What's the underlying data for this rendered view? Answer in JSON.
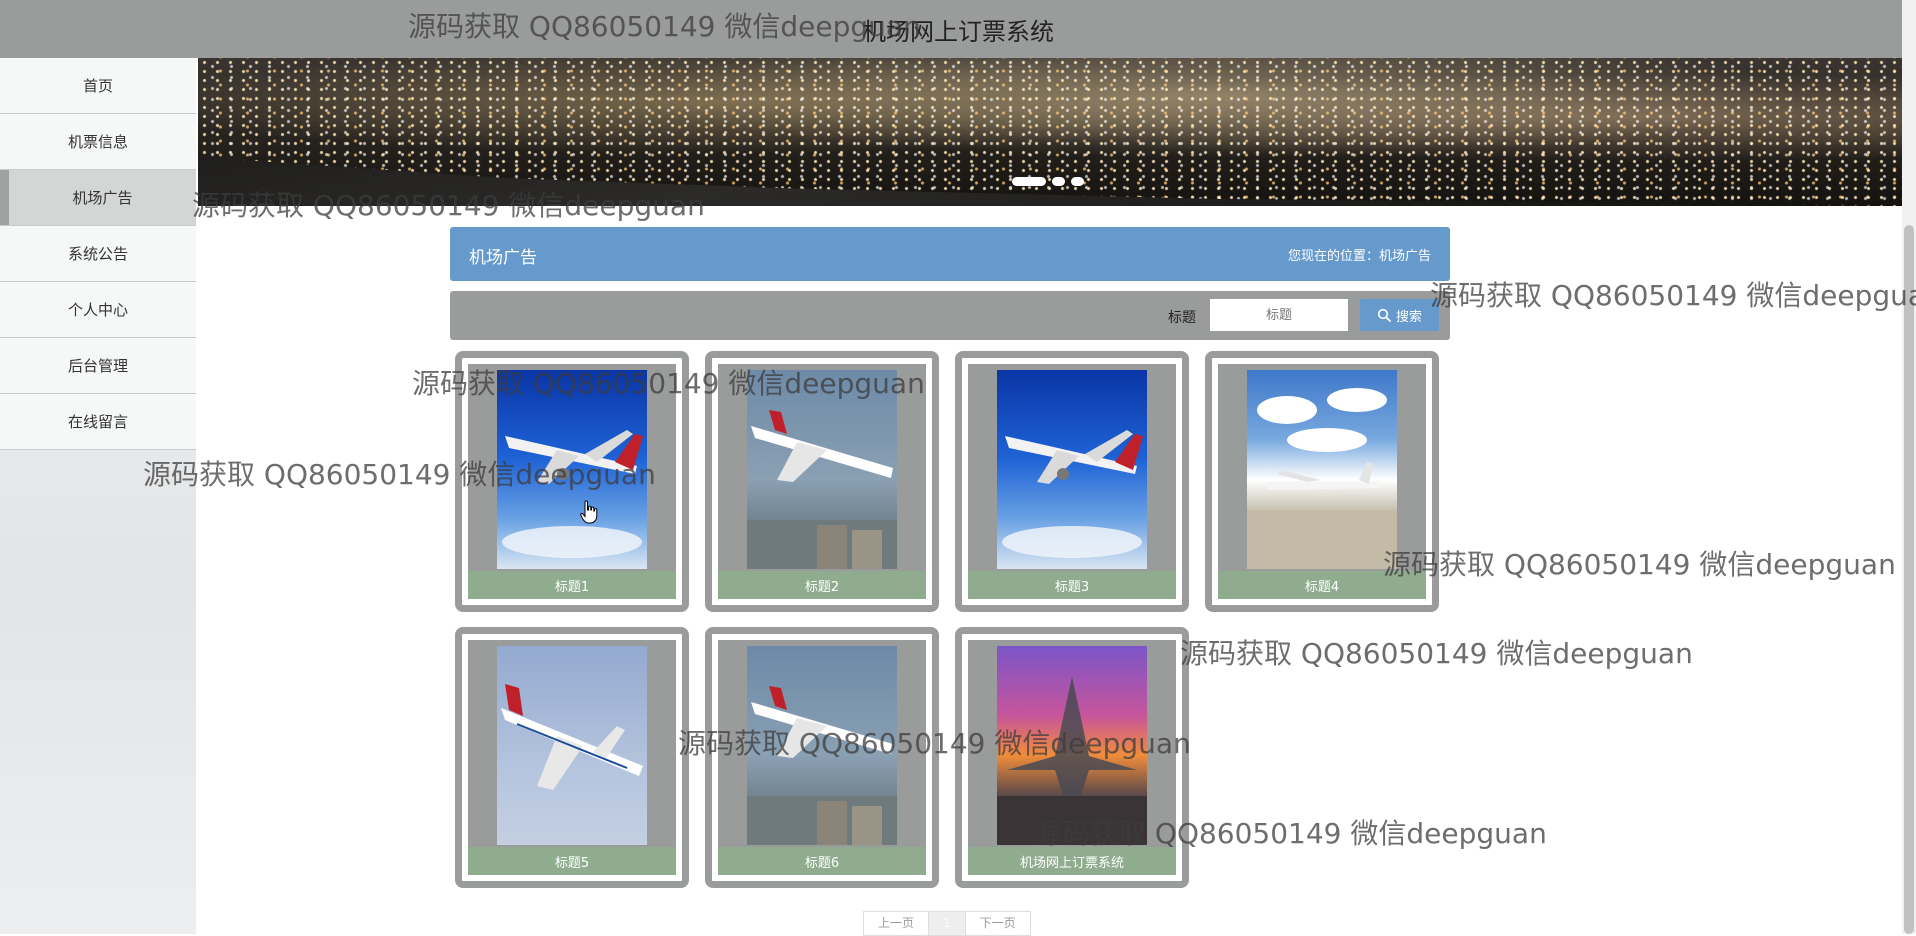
{
  "header": {
    "title": "机场网上订票系统"
  },
  "sidebar": {
    "items": [
      {
        "label": "首页",
        "active": false
      },
      {
        "label": "机票信息",
        "active": false
      },
      {
        "label": "机场广告",
        "active": true
      },
      {
        "label": "系统公告",
        "active": false
      },
      {
        "label": "个人中心",
        "active": false
      },
      {
        "label": "后台管理",
        "active": false
      },
      {
        "label": "在线留言",
        "active": false
      }
    ]
  },
  "section": {
    "title": "机场广告",
    "breadcrumb": "您现在的位置：机场广告"
  },
  "search": {
    "label": "标题",
    "placeholder": "标题",
    "button": "搜索"
  },
  "cards": [
    {
      "title": "标题1"
    },
    {
      "title": "标题2"
    },
    {
      "title": "标题3"
    },
    {
      "title": "标题4"
    },
    {
      "title": "标题5"
    },
    {
      "title": "标题6"
    },
    {
      "title": "机场网上订票系统"
    }
  ],
  "pager": {
    "prev": "上一页",
    "current": "1",
    "next": "下一页"
  },
  "watermark": "源码获取 QQ86050149 微信deepguan",
  "colors": {
    "header_bar": "#9a9c9b",
    "section_header": "#6699cc",
    "caption_bar": "#8fac8f",
    "card_border": "#9a9c9b"
  }
}
